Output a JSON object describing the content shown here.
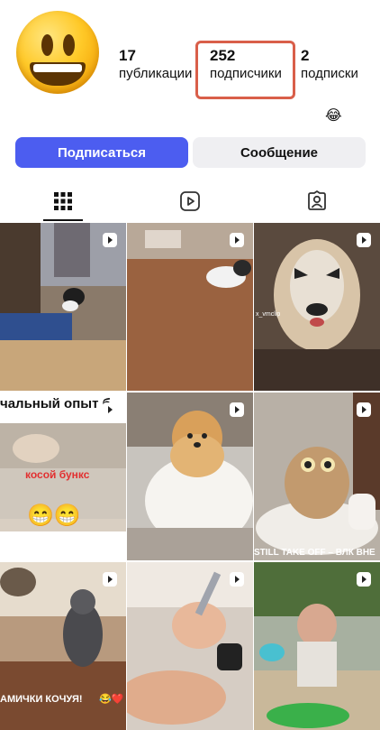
{
  "profile": {
    "avatar_icon": "grinning-face-emoji",
    "stats": [
      {
        "value": "17",
        "label": "публикации"
      },
      {
        "value": "252",
        "label": "подписчики"
      },
      {
        "value": "2",
        "label": "подписки"
      }
    ],
    "bio_emoji": "😂"
  },
  "actions": {
    "follow_label": "Подписаться",
    "message_label": "Сообщение",
    "follow_color": "#4c5df0",
    "highlight_color": "#d95f4a"
  },
  "tabs": [
    {
      "icon": "grid-icon",
      "active": true
    },
    {
      "icon": "reels-icon",
      "active": false
    },
    {
      "icon": "tagged-icon",
      "active": false
    }
  ],
  "posts": [
    {
      "type": "reel",
      "caption": ""
    },
    {
      "type": "reel",
      "caption": ""
    },
    {
      "type": "reel",
      "caption": "x_vmclip"
    },
    {
      "type": "reel",
      "caption": "чальный опыт б",
      "overlay": "косой  бункс",
      "emoji": "😁😁"
    },
    {
      "type": "reel",
      "caption": ""
    },
    {
      "type": "reel",
      "caption": "STILL TAKE OFF – ВЛК ВНЕ"
    },
    {
      "type": "reel",
      "caption": "АМИЧКИ КОЧУЯ!",
      "emoji": "😂❤️"
    },
    {
      "type": "reel",
      "caption": ""
    },
    {
      "type": "reel",
      "caption": ""
    }
  ]
}
